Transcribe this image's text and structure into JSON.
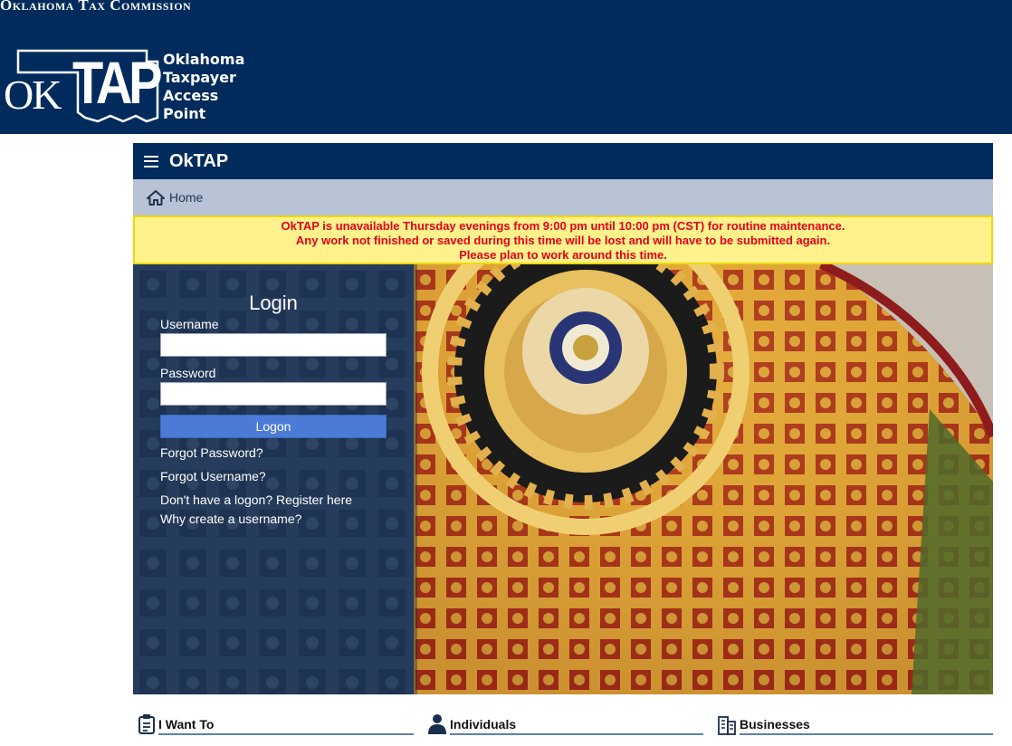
{
  "banner": {
    "agency_name": "Oklahoma Tax Commission",
    "logo_ok": "OK",
    "logo_tap": "TAP",
    "logo_lines": [
      "Oklahoma",
      "Taxpayer",
      "Access",
      "Point"
    ]
  },
  "app": {
    "title": "OkTAP",
    "breadcrumb_home": "Home"
  },
  "notice": {
    "lines": [
      "OkTAP is unavailable Thursday evenings from 9:00 pm until 10:00 pm (CST) for routine maintenance.",
      "Any work not finished or saved during this time will be lost and will have to be submitted again.",
      "Please plan to work around this time."
    ]
  },
  "login": {
    "title": "Login",
    "username_label": "Username",
    "username_value": "",
    "password_label": "Password",
    "password_value": "",
    "logon_button": "Logon",
    "links": [
      "Forgot Password?",
      "Forgot Username?",
      "Don't have a logon? Register here",
      "Why create a username?"
    ]
  },
  "sections": [
    {
      "label": "I Want To",
      "icon": "clipboard-icon"
    },
    {
      "label": "Individuals",
      "icon": "person-icon"
    },
    {
      "label": "Businesses",
      "icon": "building-icon"
    }
  ],
  "colors": {
    "navy": "#002b5c",
    "breadcrumb_bg": "#b8c4d5",
    "notice_bg": "#fff28c",
    "notice_text": "#e4001b",
    "logon_blue": "#4b7bd6"
  }
}
